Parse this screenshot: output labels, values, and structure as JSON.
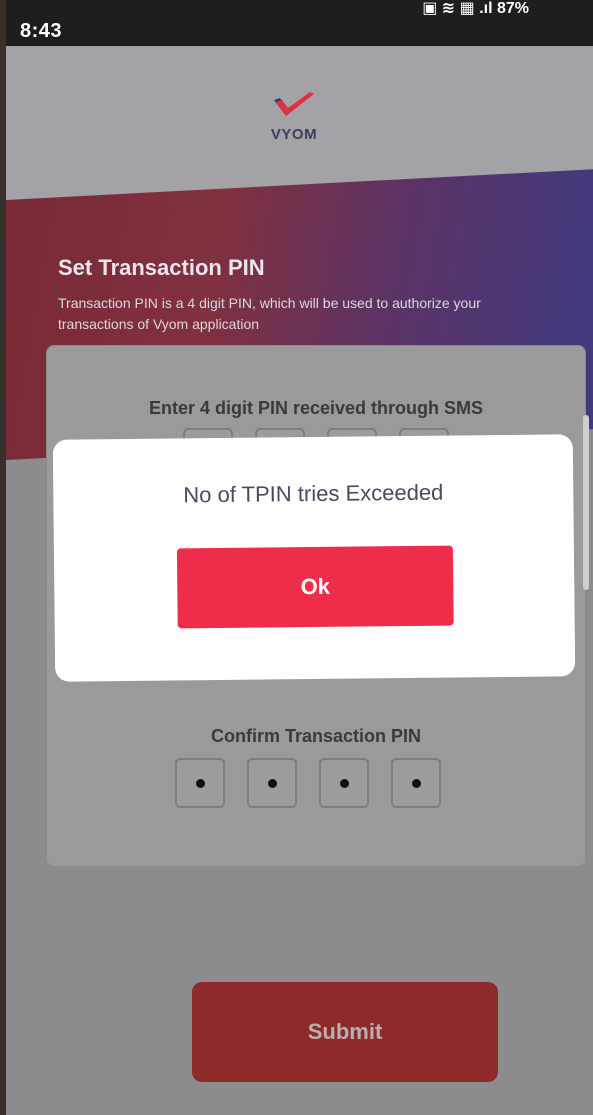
{
  "status_bar": {
    "time": "8:43",
    "icons_text": "▣ ≋ ▦ .ıl 87%"
  },
  "brand": {
    "logo_icon": "vyom-check-logo",
    "name": "VYOM",
    "colors": {
      "red": "#e0313f",
      "navy": "#2e3b6e"
    }
  },
  "banner": {
    "title": "Set Transaction PIN",
    "description": "Transaction PIN is a 4 digit PIN, which will be used to authorize your transactions of Vyom application"
  },
  "card": {
    "sms_pin_label": "Enter 4 digit PIN received through SMS",
    "confirm_pin_label": "Confirm Transaction PIN",
    "confirm_pin_digits": [
      "•",
      "•",
      "•",
      "•"
    ]
  },
  "dialog": {
    "message": "No of TPIN tries Exceeded",
    "ok_label": "Ok"
  },
  "actions": {
    "submit_label": "Submit"
  }
}
